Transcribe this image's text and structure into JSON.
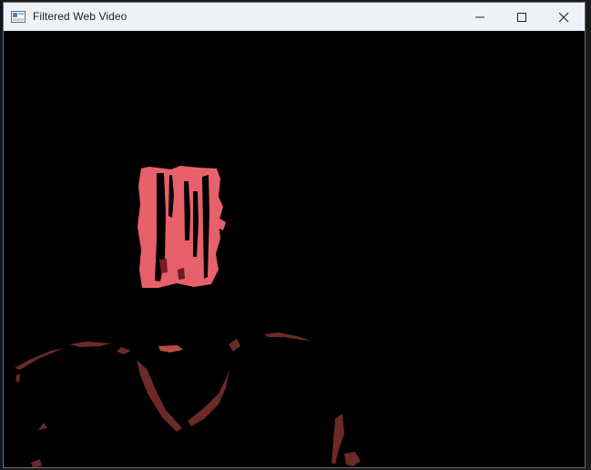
{
  "window": {
    "title": "Filtered Web Video",
    "controls": {
      "minimize": "minimize-icon",
      "maximize": "maximize-icon",
      "close": "close-icon"
    }
  },
  "colors": {
    "titlebar": "#eef1f6",
    "video_background": "#000000",
    "filtered_object": "#e8606a",
    "filtered_shadow": "#6a2a28"
  }
}
